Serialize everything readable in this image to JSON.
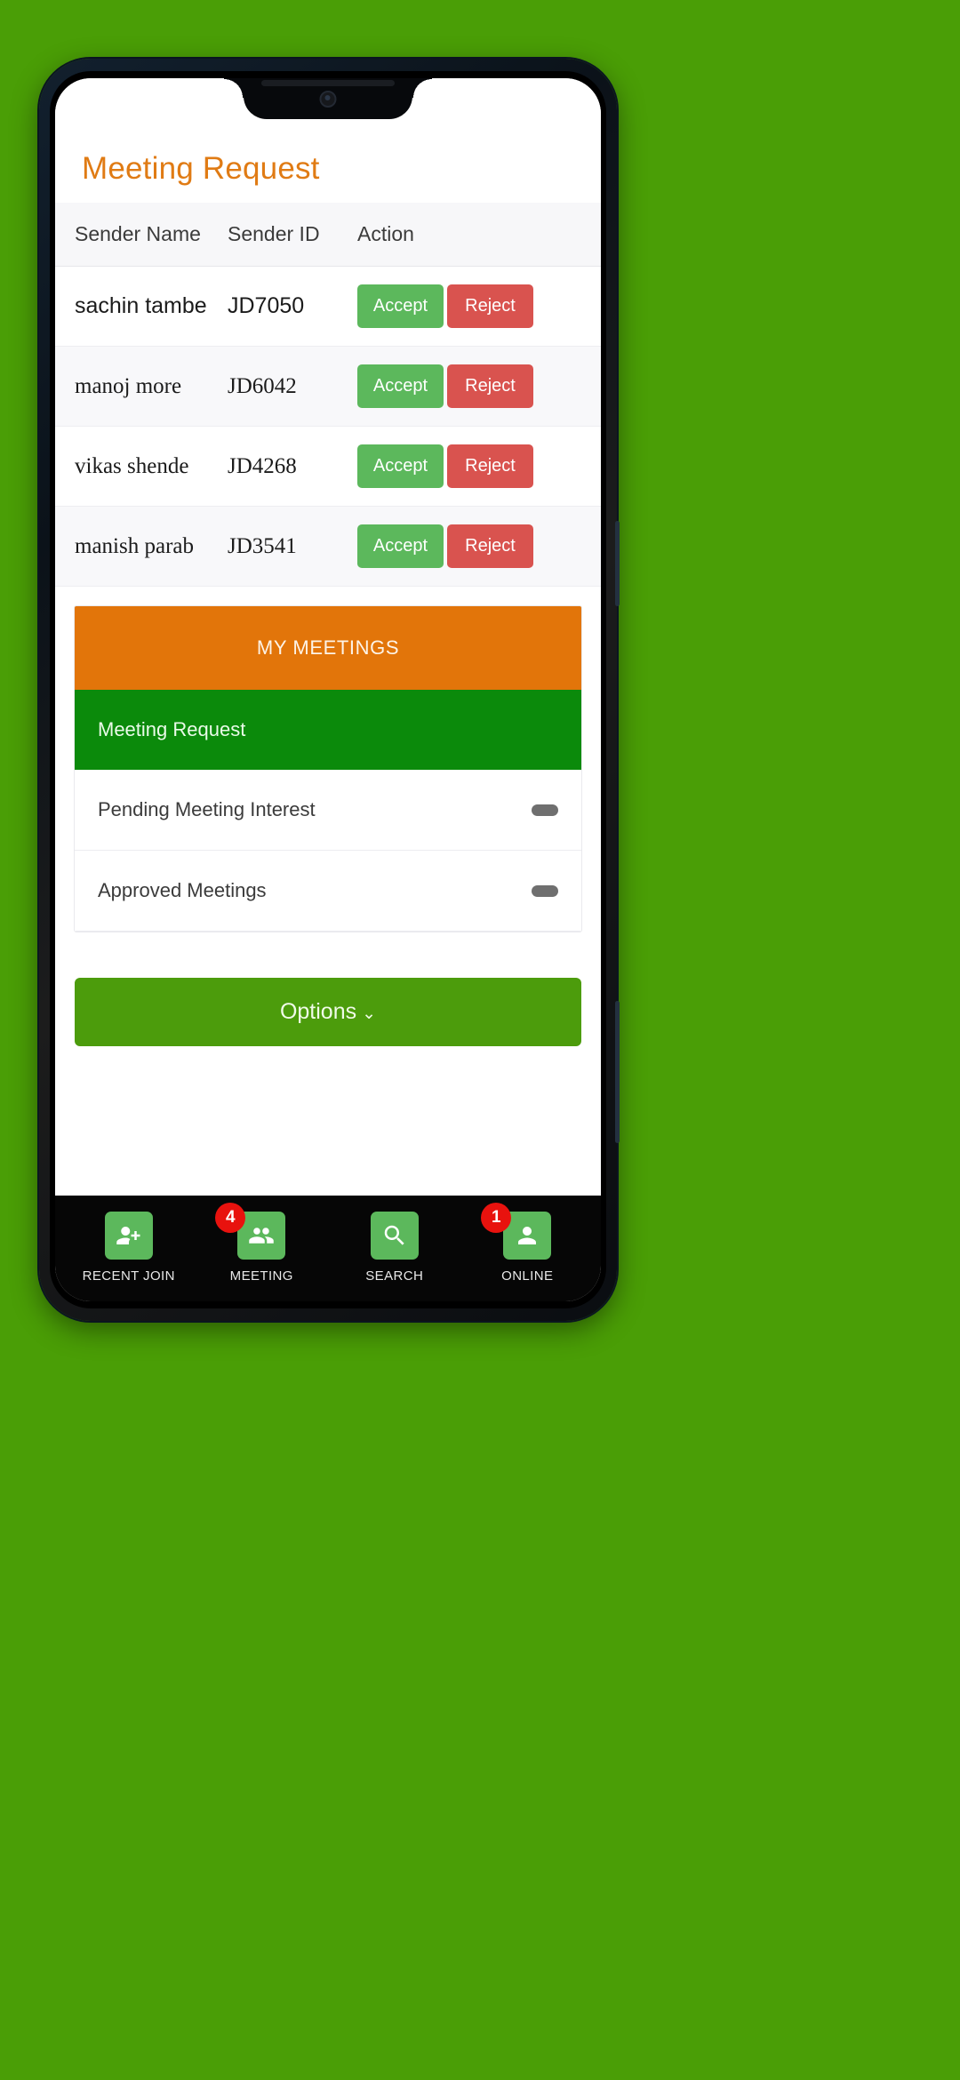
{
  "theme": {
    "page_background": "#4a9e06",
    "title_orange": "#e07b14",
    "accept_green": "#5cb85c",
    "reject_red": "#d9534f",
    "panel_orange": "#e2750a",
    "active_green": "#0b8a0b",
    "options_green": "#4c9c0c",
    "badge_red": "#e8120e"
  },
  "page": {
    "title": "Meeting Request"
  },
  "table": {
    "columns": [
      "Sender Name",
      "Sender ID",
      "Action"
    ],
    "rows": [
      {
        "name": "sachin tambe",
        "id": "JD7050",
        "accept": "Accept",
        "reject": "Reject"
      },
      {
        "name": "manoj more",
        "id": "JD6042",
        "accept": "Accept",
        "reject": "Reject"
      },
      {
        "name": "vikas shende",
        "id": "JD4268",
        "accept": "Accept",
        "reject": "Reject"
      },
      {
        "name": "manish parab",
        "id": "JD3541",
        "accept": "Accept",
        "reject": "Reject"
      }
    ]
  },
  "meetings_panel": {
    "header": "MY MEETINGS",
    "items": [
      {
        "label": "Meeting Request",
        "active": true,
        "toggle": false
      },
      {
        "label": "Pending Meeting Interest",
        "active": false,
        "toggle": true
      },
      {
        "label": "Approved Meetings",
        "active": false,
        "toggle": true
      }
    ]
  },
  "options_button": {
    "label": "Options",
    "chevron": "⌄"
  },
  "bottom_nav": {
    "items": [
      {
        "label": "RECENT JOIN",
        "icon": "user-plus-icon",
        "badge": ""
      },
      {
        "label": "MEETING",
        "icon": "group-icon",
        "badge": "4"
      },
      {
        "label": "SEARCH",
        "icon": "search-icon",
        "badge": ""
      },
      {
        "label": "ONLINE",
        "icon": "user-icon",
        "badge": "1"
      }
    ]
  }
}
